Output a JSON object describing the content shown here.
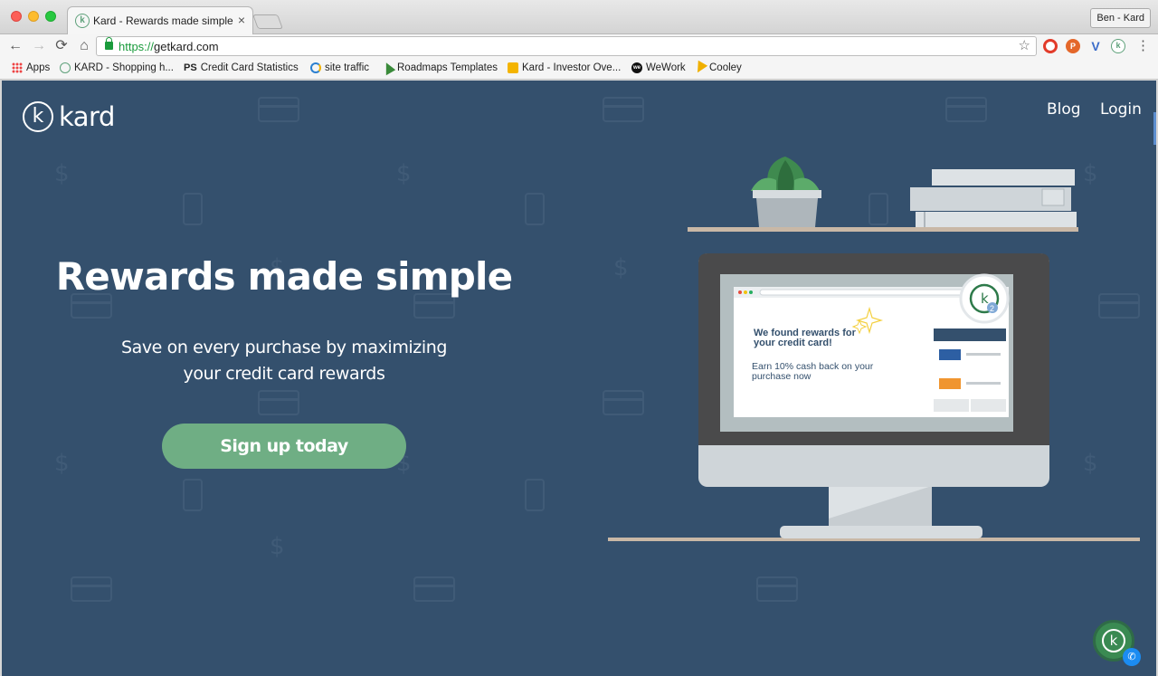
{
  "browser": {
    "tab_title": "Kard - Rewards made simple",
    "tab_close": "×",
    "profile_name": "Ben - Kard",
    "url_scheme": "https://",
    "url_host": "getkard.com",
    "nav": {
      "back": "←",
      "forward": "→",
      "reload": "⟳",
      "home": "⌂",
      "star": "☆",
      "menu": "⋮"
    },
    "extensions": {
      "p": "P",
      "v": "V",
      "k": "k"
    },
    "bookmarks": [
      {
        "label": "Apps",
        "icon": "apps-grid-icon"
      },
      {
        "label": "KARD - Shopping h...",
        "icon": "kard-icon"
      },
      {
        "label": "Credit Card Statistics",
        "icon": "ps-icon",
        "icon_text": "PS"
      },
      {
        "label": "site traffic",
        "icon": "similarweb-icon"
      },
      {
        "label": "Roadmaps Templates",
        "icon": "roadmaps-icon"
      },
      {
        "label": "Kard - Investor Ove...",
        "icon": "google-slides-icon"
      },
      {
        "label": "WeWork",
        "icon": "wework-icon",
        "icon_text": "we"
      },
      {
        "label": "Cooley",
        "icon": "cooley-icon"
      }
    ]
  },
  "site": {
    "logo_mark": "k",
    "logo_text": "kard",
    "nav": {
      "blog": "Blog",
      "login": "Login"
    },
    "hero": {
      "headline": "Rewards made simple",
      "subhead_line1": "Save on every purchase by maximizing",
      "subhead_line2": "your credit card rewards",
      "cta": "Sign up today"
    },
    "illustration": {
      "popup_title_line1": "We found rewards for",
      "popup_title_line2": "your credit card!",
      "popup_body_line1": "Earn 10% cash back on your",
      "popup_body_line2": "purchase now",
      "badge_mark": "k",
      "badge_count": "2"
    },
    "messenger": {
      "mark": "k",
      "badge": "✆"
    },
    "bg_symbols": {
      "dollar": "$"
    }
  },
  "colors": {
    "page_bg": "#34506d",
    "cta_bg": "#6fae84",
    "brand_green": "#5fa17b"
  }
}
